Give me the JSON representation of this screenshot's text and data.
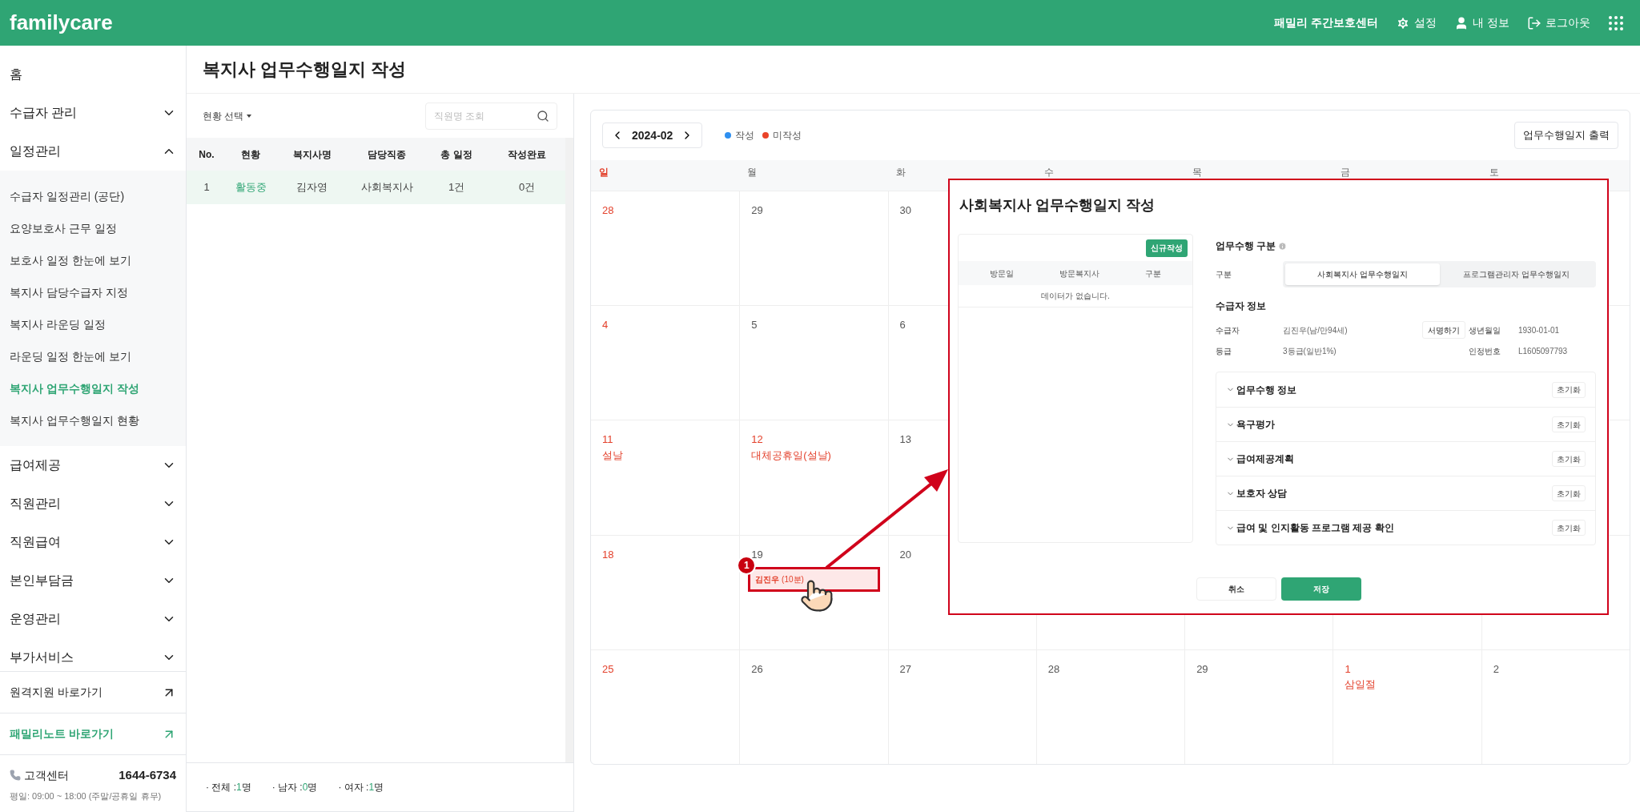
{
  "header": {
    "logo": "familycare",
    "center_name": "패밀리 주간보호센터",
    "actions": [
      {
        "kind": "settings",
        "label": "설정"
      },
      {
        "kind": "user",
        "label": "내 정보"
      },
      {
        "kind": "logout",
        "label": "로그아웃"
      }
    ]
  },
  "sidebar": {
    "items": [
      {
        "kind": "item",
        "label": "홈"
      },
      {
        "kind": "group",
        "label": "수급자 관리",
        "expanded": false
      },
      {
        "kind": "group",
        "label": "일정관리",
        "expanded": true,
        "children": [
          {
            "label": "수급자 일정관리 (공단)",
            "selected": false
          },
          {
            "label": "요양보호사 근무 일정",
            "selected": false
          },
          {
            "label": "보호사 일정 한눈에 보기",
            "selected": false
          },
          {
            "label": "복지사 담당수급자 지정",
            "selected": false
          },
          {
            "label": "복지사 라운딩 일정",
            "selected": false
          },
          {
            "label": "라운딩 일정 한눈에 보기",
            "selected": false
          },
          {
            "label": "복지사 업무수행일지 작성",
            "selected": true
          },
          {
            "label": "복지사 업무수행일지 현황",
            "selected": false
          }
        ]
      },
      {
        "kind": "group",
        "label": "급여제공",
        "expanded": false
      },
      {
        "kind": "group",
        "label": "직원관리",
        "expanded": false
      },
      {
        "kind": "group",
        "label": "직원급여",
        "expanded": false
      },
      {
        "kind": "group",
        "label": "본인부담금",
        "expanded": false
      },
      {
        "kind": "group",
        "label": "운영관리",
        "expanded": false
      },
      {
        "kind": "group",
        "label": "부가서비스",
        "expanded": false
      }
    ],
    "links": [
      {
        "label": "원격지원 바로가기",
        "highlight": false
      },
      {
        "label": "패밀리노트 바로가기",
        "highlight": true
      }
    ],
    "contact": {
      "label": "고객센터",
      "phone": "1644-6734",
      "hours": "평일: 09:00 ~ 18:00 (주말/공휴일 휴무)"
    }
  },
  "page_title": "복지사 업무수행일지 작성",
  "staff_panel": {
    "filter": "현황 선택",
    "search": {
      "placeholder": "직원명 조회"
    },
    "columns": [
      "No.",
      "현황",
      "복지사명",
      "담당직종",
      "총 일정",
      "작성완료"
    ],
    "rows": [
      {
        "cells": [
          "1",
          "활동중",
          "김자영",
          "사회복지사",
          "1건",
          "0건"
        ],
        "selected": true
      }
    ],
    "summary": [
      {
        "label": "· 전체 :",
        "count": "1",
        "unit": "명"
      },
      {
        "label": "· 남자 :",
        "count": "0",
        "unit": "명"
      },
      {
        "label": "· 여자 :",
        "count": "1",
        "unit": "명"
      }
    ]
  },
  "calendar": {
    "month": "2024-02",
    "legend": [
      {
        "label": "작성",
        "color": "#2e8ff0"
      },
      {
        "label": "미작성",
        "color": "#ea4329"
      }
    ],
    "print_button": "업무수행일지 출력",
    "weekdays": [
      {
        "label": "일",
        "red": true
      },
      {
        "label": "월",
        "red": false
      },
      {
        "label": "화",
        "red": false
      },
      {
        "label": "수",
        "red": false
      },
      {
        "label": "목",
        "red": false
      },
      {
        "label": "금",
        "red": false
      },
      {
        "label": "토",
        "red": false
      }
    ],
    "weeks": [
      {
        "days": [
          {
            "day": "28",
            "red": true
          },
          {
            "day": "29",
            "red": false
          },
          {
            "day": "30",
            "red": false
          }
        ]
      },
      {
        "days": [
          {
            "day": "4",
            "red": true
          },
          {
            "day": "5",
            "red": false
          },
          {
            "day": "6",
            "red": false
          }
        ]
      },
      {
        "days": [
          {
            "day": "11",
            "red": true,
            "holiday": "설날"
          },
          {
            "day": "12",
            "red": true,
            "holiday": "대체공휴일(설날)"
          },
          {
            "day": "13",
            "red": false
          }
        ]
      },
      {
        "days": [
          {
            "day": "18",
            "red": true
          },
          {
            "day": "19",
            "red": false,
            "event": {
              "name": "김진우",
              "duration": "(10분)",
              "badge": "1"
            }
          },
          {
            "day": "20",
            "red": false
          }
        ]
      },
      {
        "days": [
          {
            "day": "25",
            "red": true
          },
          {
            "day": "26",
            "red": false
          },
          {
            "day": "27",
            "red": false
          },
          {
            "day": "28",
            "red": false
          },
          {
            "day": "29",
            "red": false
          },
          {
            "day": "1",
            "red": true,
            "holiday": "삼일절"
          },
          {
            "day": "2",
            "red": false
          }
        ]
      }
    ]
  },
  "dialog": {
    "title": "사회복지사 업무수행일지 작성",
    "new_button": "신규작성",
    "columns": [
      "방문일",
      "방문복지사",
      "구분"
    ],
    "empty": "데이터가 없습니다.",
    "type_section": "업무수행 구분",
    "type_label": "구분",
    "type_options": [
      {
        "label": "사회복지사 업무수행일지",
        "selected": true
      },
      {
        "label": "프로그램관리자 업무수행일지",
        "selected": false
      }
    ],
    "recipient_section": "수급자 정보",
    "recipient": {
      "name_label": "수급자",
      "name": "김진우(남/만94세)",
      "sign_button": "서명하기",
      "birth_label": "생년월일",
      "birth": "1930-01-01",
      "grade_label": "등급",
      "grade": "3등급(일반1%)",
      "cert_label": "인정번호",
      "cert": "L1605097793"
    },
    "sections": [
      {
        "title": "업무수행 정보",
        "expanded": false,
        "reset": "초기화"
      },
      {
        "title": "욕구평가",
        "expanded": false,
        "reset": "초기화"
      },
      {
        "title": "급여제공계획",
        "expanded": false,
        "reset": "초기화"
      },
      {
        "title": "보호자 상담",
        "expanded": false,
        "reset": "초기화"
      },
      {
        "title": "급여 및 인지활동 프로그램 제공 확인",
        "expanded": false,
        "reset": "초기화"
      }
    ],
    "buttons": [
      {
        "kind": "cancel",
        "label": "취소"
      },
      {
        "kind": "save",
        "label": "저장"
      }
    ]
  }
}
